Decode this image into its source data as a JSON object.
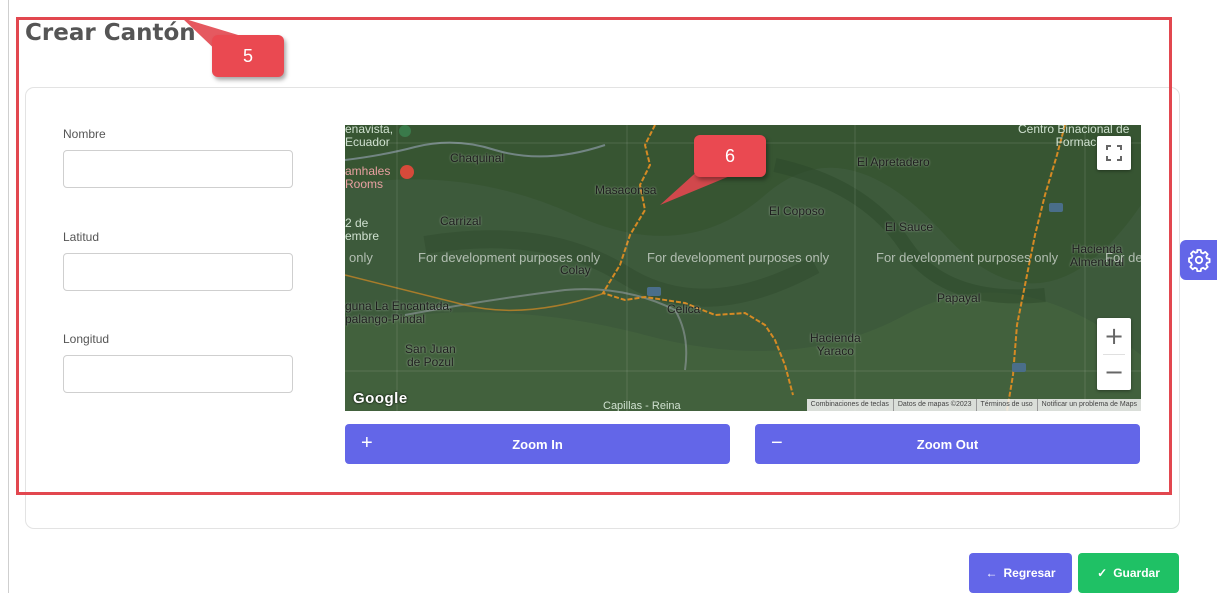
{
  "title": "Crear Cantón",
  "form": {
    "nombre_label": "Nombre",
    "nombre_value": "",
    "latitud_label": "Latitud",
    "latitud_value": "",
    "longitud_label": "Longitud",
    "longitud_value": ""
  },
  "map": {
    "places": [
      {
        "name": "Chaquinal"
      },
      {
        "name": "Masaconsa"
      },
      {
        "name": "Carrizal"
      },
      {
        "name": "El Coposo"
      },
      {
        "name": "El Apretadero"
      },
      {
        "name": "El Sauce"
      },
      {
        "name": "Colay"
      },
      {
        "name": "Celica"
      },
      {
        "name": "Papayal"
      },
      {
        "name": "Hacienda\nYaraco"
      },
      {
        "name": "San Juan\nde Pozul"
      },
      {
        "name": "Hacienda\nAlmendral"
      },
      {
        "name": "guna La Encantada,\npalango-Pindal"
      },
      {
        "name": "2 de\nembre"
      },
      {
        "name": "enavista,\nEcuador"
      },
      {
        "name": "amhales\nRooms"
      },
      {
        "name": "Centro Binacional de\nFormación Té"
      },
      {
        "name": "Capillas - Reina"
      }
    ],
    "dev_watermarks": [
      "only",
      "For development purposes only",
      "For development purposes only",
      "For development purposes only",
      "For de"
    ],
    "attribution": [
      "Combinaciones de teclas",
      "Datos de mapas ©2023",
      "Términos de uso",
      "Notificar un problema de Maps"
    ],
    "google_logo": "Google",
    "zoom_in_symbol": "+",
    "zoom_out_symbol": "−"
  },
  "buttons": {
    "zoom_in": "Zoom In",
    "zoom_in_icon": "+",
    "zoom_out": "Zoom Out",
    "zoom_out_icon": "−",
    "back": "Regresar",
    "back_icon": "←",
    "save": "Guardar",
    "save_icon": "✓"
  },
  "annotations": {
    "callout_5": "5",
    "callout_6": "6"
  },
  "colors": {
    "accent": "#6366e8",
    "success": "#1fc165",
    "annotation": "#e2474f",
    "map_background": "#3c5a3a"
  },
  "icons": {
    "settings": "gear-icon",
    "fullscreen": "fullscreen-icon"
  }
}
